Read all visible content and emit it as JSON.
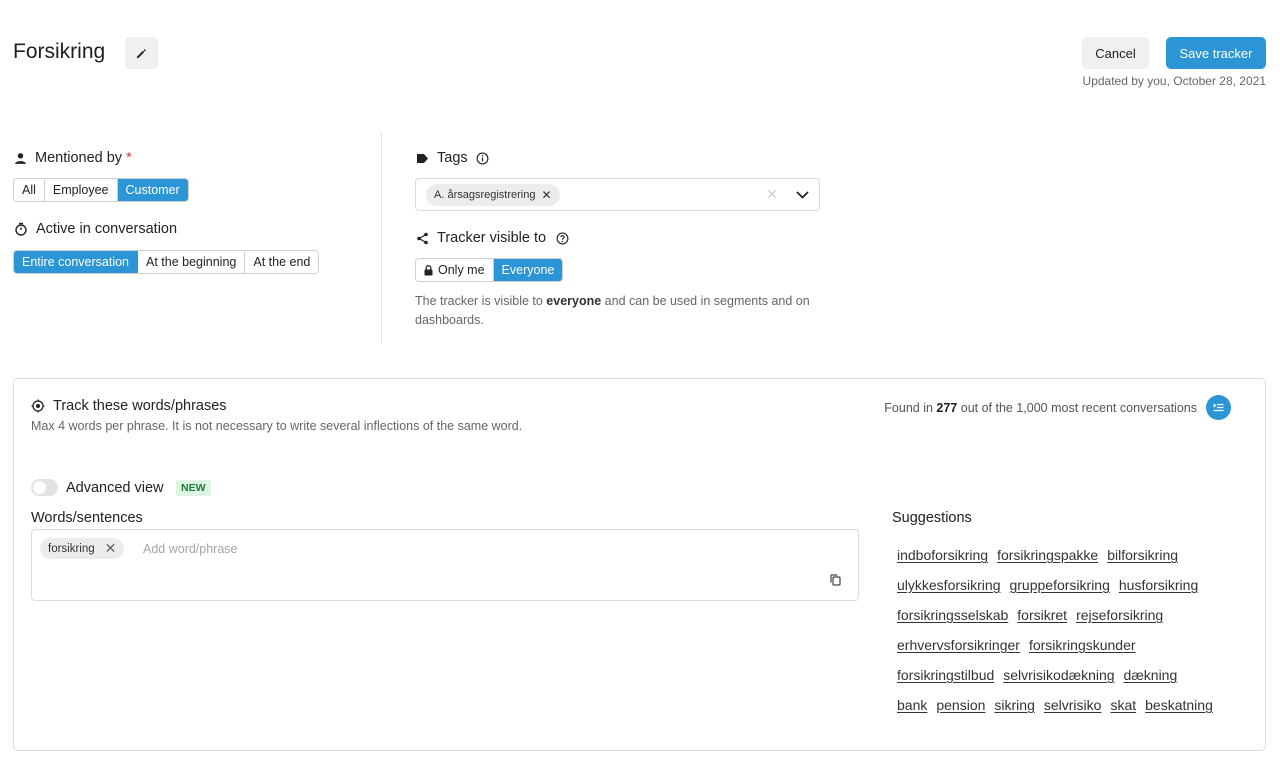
{
  "header": {
    "title": "Forsikring",
    "cancel_label": "Cancel",
    "save_label": "Save tracker",
    "updated_text": "Updated by you, October 28, 2021"
  },
  "mentioned_by": {
    "label": "Mentioned by",
    "required_mark": "*",
    "options": [
      "All",
      "Employee",
      "Customer"
    ],
    "selected": "Customer"
  },
  "active_in": {
    "label": "Active in conversation",
    "options": [
      "Entire conversation",
      "At the beginning",
      "At the end"
    ],
    "selected": "Entire conversation"
  },
  "tags": {
    "label": "Tags",
    "selected_chips": [
      "A. årsagsregistrering"
    ]
  },
  "visibility": {
    "label": "Tracker visible to",
    "options": [
      "Only me",
      "Everyone"
    ],
    "selected": "Everyone",
    "help_prefix": "The tracker is visible to ",
    "help_bold": "everyone",
    "help_suffix": " and can be used in segments and on dashboards."
  },
  "track": {
    "title": "Track these words/phrases",
    "subtitle": "Max 4 words per phrase. It is not necessary to write several inflections of the same word.",
    "found_prefix": "Found in ",
    "found_count": "277",
    "found_suffix": " out of the 1,000 most recent conversations",
    "advanced_view_label": "Advanced view",
    "advanced_view_on": false,
    "new_badge": "NEW",
    "words_label": "Words/sentences",
    "words": [
      "forsikring"
    ],
    "add_placeholder": "Add word/phrase",
    "suggestions_label": "Suggestions",
    "suggestions": [
      [
        "indboforsikring",
        "forsikringspakke",
        "bilforsikring"
      ],
      [
        "ulykkesforsikring",
        "gruppeforsikring",
        "husforsikring"
      ],
      [
        "forsikringsselskab",
        "forsikret",
        "rejseforsikring"
      ],
      [
        "erhvervsforsikringer",
        "forsikringskunder"
      ],
      [
        "forsikringstilbud",
        "selvrisikodækning",
        "dækning"
      ],
      [
        "bank",
        "pension",
        "sikring",
        "selvrisiko",
        "skat",
        "beskatning"
      ]
    ]
  },
  "colors": {
    "accent": "#2b95d6",
    "required": "#d9363e",
    "new_badge_bg": "#dff5e3",
    "new_badge_text": "#1e7b3a"
  }
}
